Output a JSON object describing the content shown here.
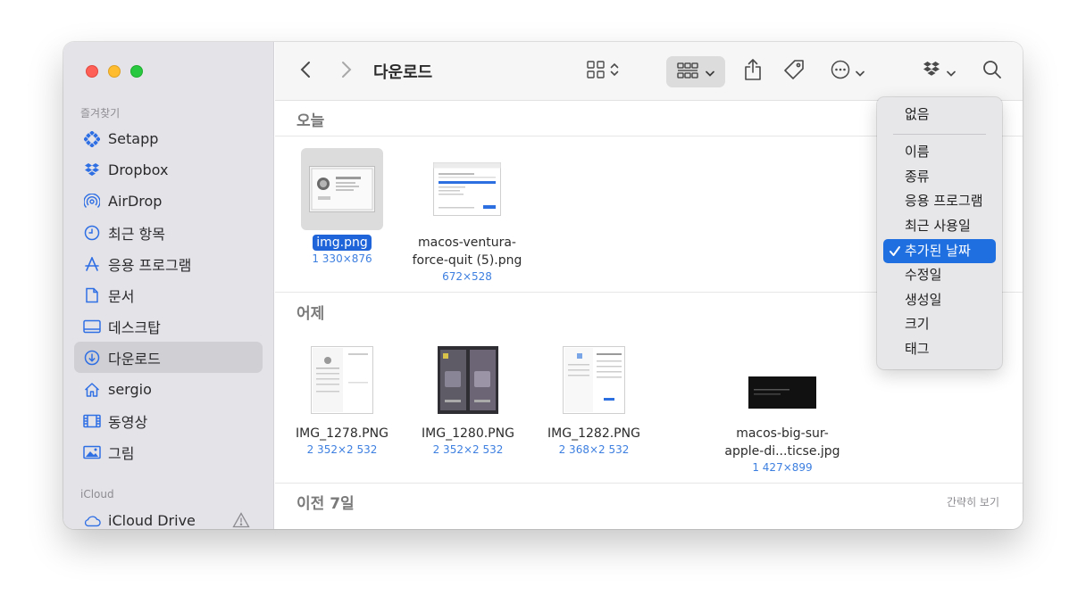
{
  "sidebar": {
    "favorites_label": "즐겨찾기",
    "icloud_label": "iCloud",
    "items": [
      {
        "label": "Setapp",
        "icon": "setapp-icon"
      },
      {
        "label": "Dropbox",
        "icon": "dropbox-icon"
      },
      {
        "label": "AirDrop",
        "icon": "airdrop-icon"
      },
      {
        "label": "최근 항목",
        "icon": "clock-icon"
      },
      {
        "label": "응용 프로그램",
        "icon": "applications-icon"
      },
      {
        "label": "문서",
        "icon": "document-icon"
      },
      {
        "label": "데스크탑",
        "icon": "desktop-icon"
      },
      {
        "label": "다운로드",
        "icon": "download-icon",
        "selected": true
      },
      {
        "label": "sergio",
        "icon": "home-icon"
      },
      {
        "label": "동영상",
        "icon": "film-icon"
      },
      {
        "label": "그림",
        "icon": "picture-icon"
      }
    ],
    "icloud_items": [
      {
        "label": "iCloud Drive",
        "icon": "cloud-icon"
      }
    ]
  },
  "toolbar": {
    "title": "다운로드"
  },
  "groups": [
    {
      "title": "오늘",
      "files": [
        {
          "name": "img.png",
          "dims": "1 330×876",
          "selected": true
        },
        {
          "name": "macos-ventura-force-quit (5).png",
          "name_line1": "macos-ventura-",
          "name_line2": "force-quit (5).png",
          "dims": "672×528"
        }
      ]
    },
    {
      "title": "어제",
      "files": [
        {
          "name": "IMG_1278.PNG",
          "dims": "2 352×2 532"
        },
        {
          "name": "IMG_1280.PNG",
          "dims": "2 352×2 532"
        },
        {
          "name": "IMG_1282.PNG",
          "dims": "2 368×2 532"
        },
        {
          "name": "macos-big-sur-apple-di...ticse.jpg",
          "name_line1": "macos-big-sur-",
          "name_line2": "apple-di...ticse.jpg",
          "dims": "1 427×899"
        }
      ]
    },
    {
      "title": "이전 7일",
      "collapse_label": "간략히 보기"
    }
  ],
  "sort_menu": {
    "none_label": "없음",
    "items": [
      "이름",
      "종류",
      "응용 프로그램",
      "최근 사용일",
      "추가된 날짜",
      "수정일",
      "생성일",
      "크기",
      "태그"
    ],
    "checked_index": 4,
    "accent_color": "#1f6fe0"
  }
}
